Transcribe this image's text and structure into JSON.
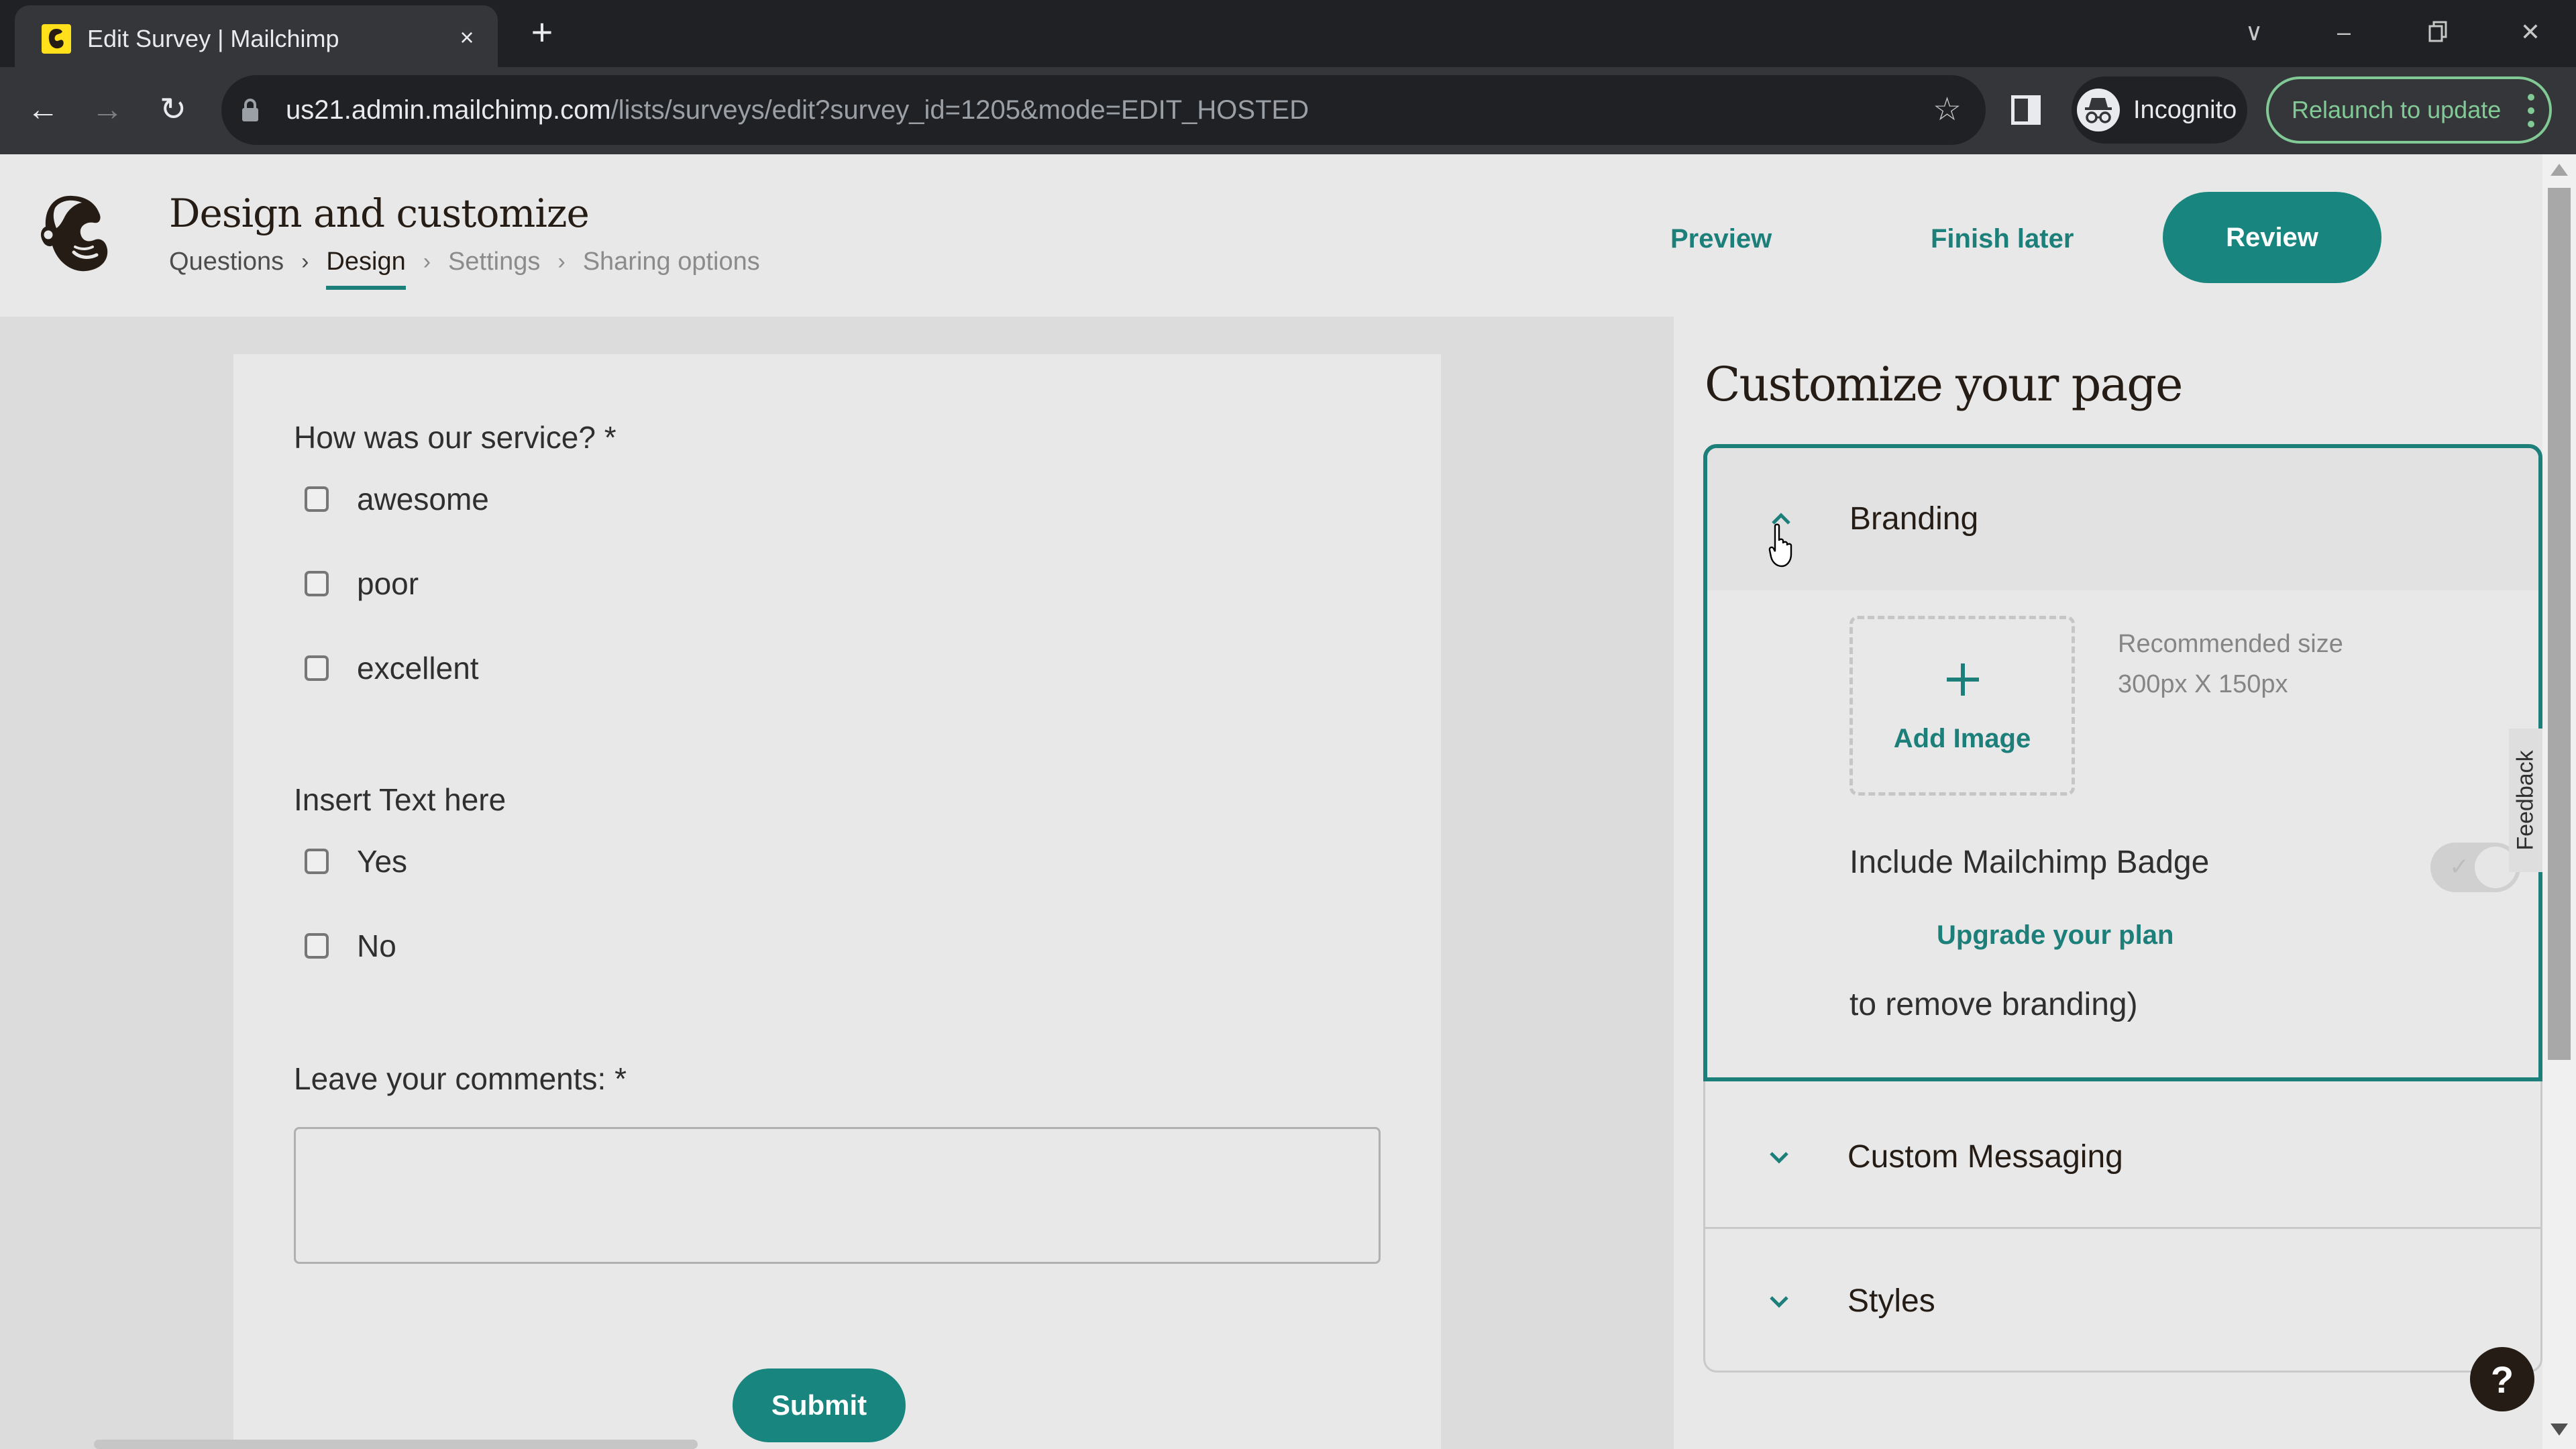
{
  "browser": {
    "tab_title": "Edit Survey | Mailchimp",
    "tab_close_icon": "close-icon",
    "new_tab_icon": "plus-icon",
    "url_host": "us21.admin.mailchimp.com",
    "url_path": "/lists/surveys/edit?survey_id=1205&mode=EDIT_HOSTED",
    "incognito_label": "Incognito",
    "relaunch_label": "Relaunch to update",
    "controls": {
      "tab_search": "∨",
      "minimize": "–",
      "restore": "❐",
      "close": "✕"
    },
    "nav": {
      "back": "←",
      "forward": "→",
      "reload": "↻"
    },
    "bookmark_star": "☆"
  },
  "header": {
    "title": "Design and customize",
    "breadcrumb": [
      {
        "label": "Questions",
        "state": "done"
      },
      {
        "label": "Design",
        "state": "active"
      },
      {
        "label": "Settings",
        "state": "upcoming"
      },
      {
        "label": "Sharing options",
        "state": "upcoming"
      }
    ],
    "breadcrumb_sep": "›",
    "preview_label": "Preview",
    "finish_later_label": "Finish later",
    "review_label": "Review"
  },
  "form": {
    "questions": [
      {
        "label": "How was our service? *",
        "options": [
          "awesome",
          "poor",
          "excellent"
        ]
      },
      {
        "label": "Insert Text here",
        "options": [
          "Yes",
          "No"
        ]
      }
    ],
    "comments_label": "Leave your comments: *",
    "comments_value": "",
    "submit_label": "Submit"
  },
  "panel": {
    "title": "Customize your page",
    "branding": {
      "title": "Branding",
      "expanded": true,
      "add_image_label": "Add Image",
      "recommended_line1": "Recommended size",
      "recommended_line2": "300px X 150px",
      "badge_label": "Include Mailchimp Badge",
      "badge_enabled": true,
      "badge_toggle_disabled": true,
      "upgrade_link": "Upgrade your plan",
      "remove_text": "to remove branding)"
    },
    "sections": [
      {
        "title": "Custom Messaging",
        "expanded": false
      },
      {
        "title": "Styles",
        "expanded": false
      }
    ],
    "feedback_label": "Feedback",
    "help_label": "?"
  },
  "colors": {
    "brand_teal": "#18857f",
    "link_teal": "#1d7f7a",
    "relaunch_green": "#81c995",
    "mailchimp_yellow": "#ffe01b"
  }
}
